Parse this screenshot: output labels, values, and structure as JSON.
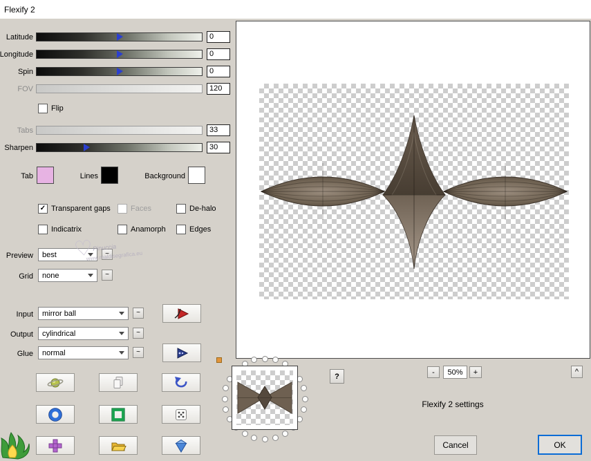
{
  "window": {
    "title": "Flexify 2"
  },
  "controls": {
    "sliders": [
      {
        "label": "Latitude",
        "value": "0"
      },
      {
        "label": "Longitude",
        "value": "0"
      },
      {
        "label": "Spin",
        "value": "0"
      },
      {
        "label": "FOV",
        "value": "120"
      },
      {
        "label": "Tabs",
        "value": "33"
      },
      {
        "label": "Sharpen",
        "value": "30"
      }
    ],
    "flip": {
      "label": "Flip",
      "mark": ""
    },
    "swatches": [
      {
        "label": "Tab",
        "color": "#e7b3e3"
      },
      {
        "label": "Lines",
        "color": "#000000"
      },
      {
        "label": "Background",
        "color": "#ffffff"
      }
    ],
    "checkboxes": [
      {
        "label": "Transparent gaps",
        "mark": "✓"
      },
      {
        "label": "Faces",
        "mark": ""
      },
      {
        "label": "De-halo",
        "mark": ""
      },
      {
        "label": "Indicatrix",
        "mark": ""
      },
      {
        "label": "Anamorph",
        "mark": ""
      },
      {
        "label": "Edges",
        "mark": ""
      }
    ],
    "dropdowns": [
      {
        "label": "Preview",
        "value": "best"
      },
      {
        "label": "Grid",
        "value": "none"
      },
      {
        "label": "Input",
        "value": "mirror ball"
      },
      {
        "label": "Output",
        "value": "cylindrical"
      },
      {
        "label": "Glue",
        "value": "normal"
      }
    ],
    "cycle_glyph": "~"
  },
  "preview_bar": {
    "help": "?",
    "zoom_out": "-",
    "zoom_level": "50%",
    "zoom_in": "+",
    "collapse": "^"
  },
  "footer": {
    "settings_label": "Flexify 2 settings",
    "cancel": "Cancel",
    "ok": "OK"
  },
  "watermark": {
    "heart": "♡",
    "name": "Pinuccia",
    "url": "www.maldisegrafica.eu"
  }
}
